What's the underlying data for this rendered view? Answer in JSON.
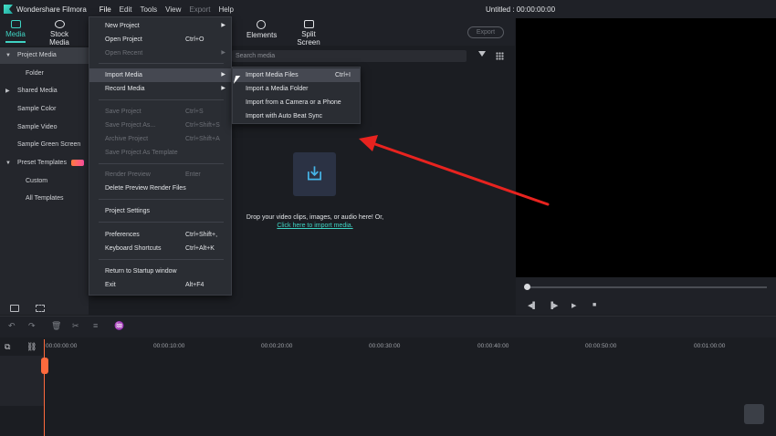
{
  "titlebar": {
    "app_name": "Wondershare Filmora",
    "menus": [
      "File",
      "Edit",
      "Tools",
      "View",
      "Export",
      "Help"
    ],
    "doc_title": "Untitled : 00:00:00:00"
  },
  "top_tabs": {
    "media": "Media",
    "stock_media": "Stock Media",
    "elements": "Elements",
    "split_screen": "Split Screen",
    "export": "Export"
  },
  "sidebar": {
    "items": [
      {
        "label": "Project Media"
      },
      {
        "label": "Folder"
      },
      {
        "label": "Shared Media"
      },
      {
        "label": "Sample Color"
      },
      {
        "label": "Sample Video"
      },
      {
        "label": "Sample Green Screen"
      },
      {
        "label": "Preset Templates"
      },
      {
        "label": "Custom"
      },
      {
        "label": "All Templates"
      }
    ]
  },
  "search": {
    "placeholder": "Search media"
  },
  "dropzone": {
    "text": "Drop your video clips, images, or audio here! Or,",
    "link": "Click here to import media."
  },
  "file_menu": {
    "items": [
      {
        "label": "New Project",
        "shortcut": ""
      },
      {
        "label": "Open Project",
        "shortcut": "Ctrl+O"
      },
      {
        "label": "Open Recent",
        "shortcut": ""
      },
      {
        "label": "Import Media",
        "shortcut": ""
      },
      {
        "label": "Record Media",
        "shortcut": ""
      },
      {
        "label": "Save Project",
        "shortcut": "Ctrl+S"
      },
      {
        "label": "Save Project As...",
        "shortcut": "Ctrl+Shift+S"
      },
      {
        "label": "Archive Project",
        "shortcut": "Ctrl+Shift+A"
      },
      {
        "label": "Save Project As Template",
        "shortcut": ""
      },
      {
        "label": "Render Preview",
        "shortcut": "Enter"
      },
      {
        "label": "Delete Preview Render Files",
        "shortcut": ""
      },
      {
        "label": "Project Settings",
        "shortcut": ""
      },
      {
        "label": "Preferences",
        "shortcut": "Ctrl+Shift+,"
      },
      {
        "label": "Keyboard Shortcuts",
        "shortcut": "Ctrl+Alt+K"
      },
      {
        "label": "Return to Startup window",
        "shortcut": ""
      },
      {
        "label": "Exit",
        "shortcut": "Alt+F4"
      }
    ]
  },
  "import_submenu": {
    "items": [
      {
        "label": "Import Media Files",
        "shortcut": "Ctrl+I"
      },
      {
        "label": "Import a Media Folder",
        "shortcut": ""
      },
      {
        "label": "Import from a Camera or a Phone",
        "shortcut": ""
      },
      {
        "label": "Import with Auto Beat Sync",
        "shortcut": ""
      }
    ]
  },
  "timeline": {
    "ticks": [
      "00:00:00:00",
      "00:00:10:00",
      "00:00:20:00",
      "00:00:30:00",
      "00:00:40:00",
      "00:00:50:00",
      "00:01:00:00"
    ]
  },
  "colors": {
    "accent": "#3fd3c3",
    "annotation_arrow": "#e8231f",
    "playhead": "#ff6a3d"
  }
}
